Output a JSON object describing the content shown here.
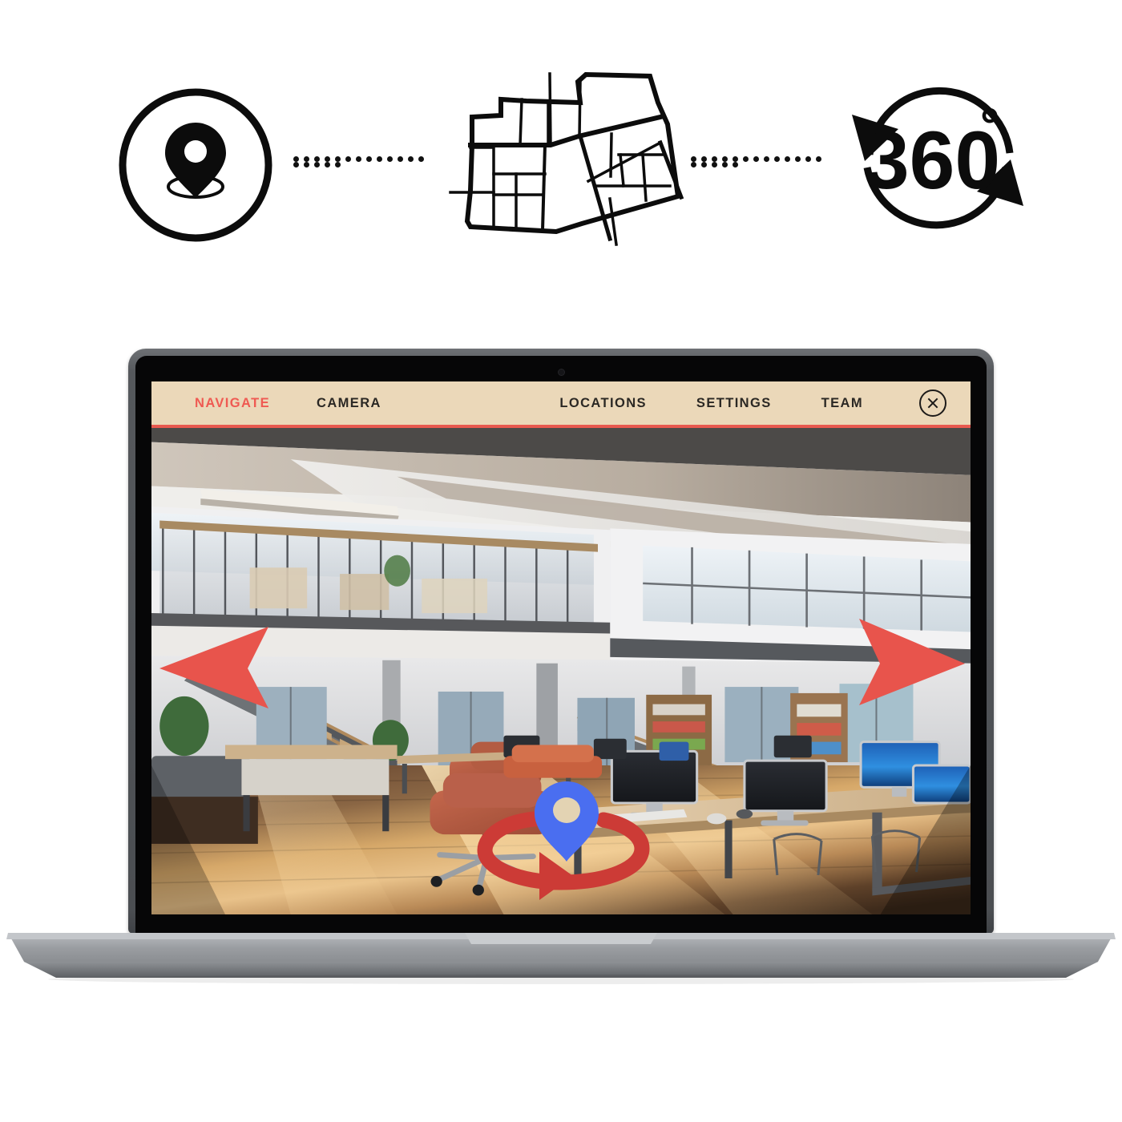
{
  "header_icons": {
    "left": {
      "name": "map-pin-in-circle",
      "label": "location-pin"
    },
    "middle": {
      "name": "floor-plan-map",
      "label": "floor-plan"
    },
    "right": {
      "name": "360-rotation",
      "label": "360",
      "degree_symbol": "°"
    },
    "connector": {
      "name": "dotted-connector",
      "dot_count": 18
    }
  },
  "app": {
    "menu_left": [
      {
        "label": "NAVIGATE",
        "active": true
      },
      {
        "label": "CAMERA",
        "active": false
      }
    ],
    "menu_right": [
      {
        "label": "LOCATIONS",
        "active": false
      },
      {
        "label": "SETTINGS",
        "active": false
      },
      {
        "label": "TEAM",
        "active": false
      }
    ],
    "close_label": "Close"
  },
  "viewport": {
    "scene_description": "Modern open-plan office interior with mezzanine, staircase, wooden floor and desks",
    "controls": {
      "pan_left": "Pan left",
      "pan_right": "Pan right",
      "rotate_marker": "360 rotate here"
    }
  },
  "colors": {
    "menu_background": "#ebd8b9",
    "accent_red": "#e8594f",
    "accent_active": "#ef5a52",
    "menu_text": "#2b2824",
    "pin_blue": "#4a6ef0",
    "pin_center": "#e3d3b3",
    "arrow_red": "#e8544c",
    "laptop_body": "#55585c",
    "laptop_base": "#8b8e92",
    "ink_black": "#111111"
  }
}
